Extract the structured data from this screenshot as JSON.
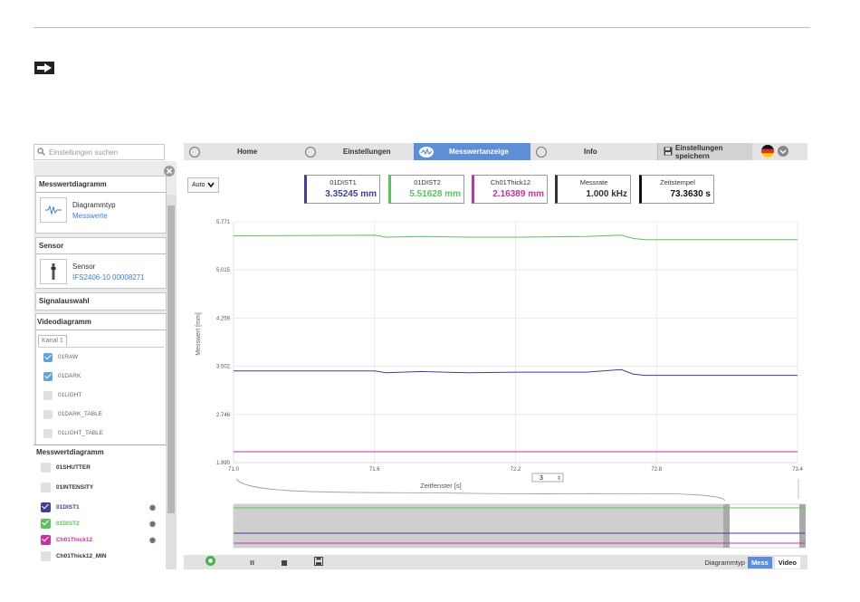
{
  "search": {
    "placeholder": "Einstellungen suchen"
  },
  "nav": {
    "home": "Home",
    "settings": "Einstellungen",
    "measurement_display": "Messwertanzeige",
    "info": "Info",
    "save": "Einstellungen speichern"
  },
  "sidebar": {
    "measurement_diagram": {
      "title": "Messwertdiagramm",
      "label": "Diagrammtyp",
      "value": "Messwerte"
    },
    "sensor": {
      "title": "Sensor",
      "label": "Sensor",
      "value": "IFS2406-10 00008271"
    },
    "signal_selection": "Signalauswahl",
    "video_diagram": {
      "title": "Videodiagramm",
      "tab": "Kanal 1",
      "channels": [
        {
          "label": "01RAW",
          "checked": true
        },
        {
          "label": "01DARK",
          "checked": true
        },
        {
          "label": "01LIGHT",
          "checked": false
        },
        {
          "label": "01DARK_TABLE",
          "checked": false
        },
        {
          "label": "01LIGHT_TABLE",
          "checked": false
        }
      ]
    },
    "value_diagram": {
      "title": "Messwertdiagramm",
      "channels": [
        {
          "label": "01SHUTTER",
          "checked": false,
          "color": "#333333"
        },
        {
          "label": "01INTENSITY",
          "checked": false,
          "color": "#333333"
        },
        {
          "label": "01DIST1",
          "checked": true,
          "color": "#3f3f9a"
        },
        {
          "label": "01DIST2",
          "checked": true,
          "color": "#5ac45a"
        },
        {
          "label": "Ch01Thick12",
          "checked": true,
          "color": "#c2349e"
        },
        {
          "label": "Ch01Thick12_MIN",
          "checked": false,
          "color": "#333333"
        }
      ]
    }
  },
  "main": {
    "scale_select": "Auto",
    "values": [
      {
        "label": "01DIST1",
        "value": "3.35245 mm",
        "color": "#3f3f9a"
      },
      {
        "label": "01DIST2",
        "value": "5.51628 mm",
        "color": "#5ac45a"
      },
      {
        "label": "Ch01Thick12",
        "value": "2.16389 mm",
        "color": "#c2349e"
      },
      {
        "label": "Messrate",
        "value": "1.000 kHz",
        "color": "#333333"
      },
      {
        "label": "Zeitstempel",
        "value": "73.3630 s",
        "color": "#111111"
      }
    ],
    "window_value": "3",
    "footer": {
      "diagram_type": "Diagrammtyp",
      "mess": "Mess",
      "video": "Video"
    }
  },
  "chart_data": {
    "type": "line",
    "ylabel": "Messwert [mm]",
    "xlabel": "Zeitfenster [s]",
    "xlim": [
      71.0,
      73.4
    ],
    "ylim": [
      1.99,
      5.771
    ],
    "xticks": [
      "71.0",
      "71.6",
      "72.2",
      "72.8",
      "73.4"
    ],
    "yticks": [
      "1.990",
      "2.746",
      "3.502",
      "4.259",
      "5.015",
      "5.771"
    ],
    "series": [
      {
        "name": "01DIST2",
        "color": "#5ac45a",
        "x": [
          71.0,
          71.6,
          71.65,
          71.8,
          72.0,
          72.2,
          72.5,
          72.65,
          72.7,
          72.75,
          72.8,
          73.4
        ],
        "y": [
          5.55,
          5.56,
          5.53,
          5.54,
          5.53,
          5.53,
          5.54,
          5.56,
          5.51,
          5.49,
          5.49,
          5.49
        ]
      },
      {
        "name": "01DIST1",
        "color": "#3f3f9a",
        "x": [
          71.0,
          71.6,
          71.65,
          71.8,
          72.0,
          72.2,
          72.5,
          72.65,
          72.7,
          72.75,
          72.8,
          73.4
        ],
        "y": [
          3.43,
          3.43,
          3.4,
          3.42,
          3.4,
          3.41,
          3.41,
          3.45,
          3.38,
          3.36,
          3.36,
          3.36
        ]
      },
      {
        "name": "Ch01Thick12",
        "color": "#c2349e",
        "x": [
          71.0,
          73.4
        ],
        "y": [
          2.16,
          2.16
        ]
      }
    ]
  }
}
